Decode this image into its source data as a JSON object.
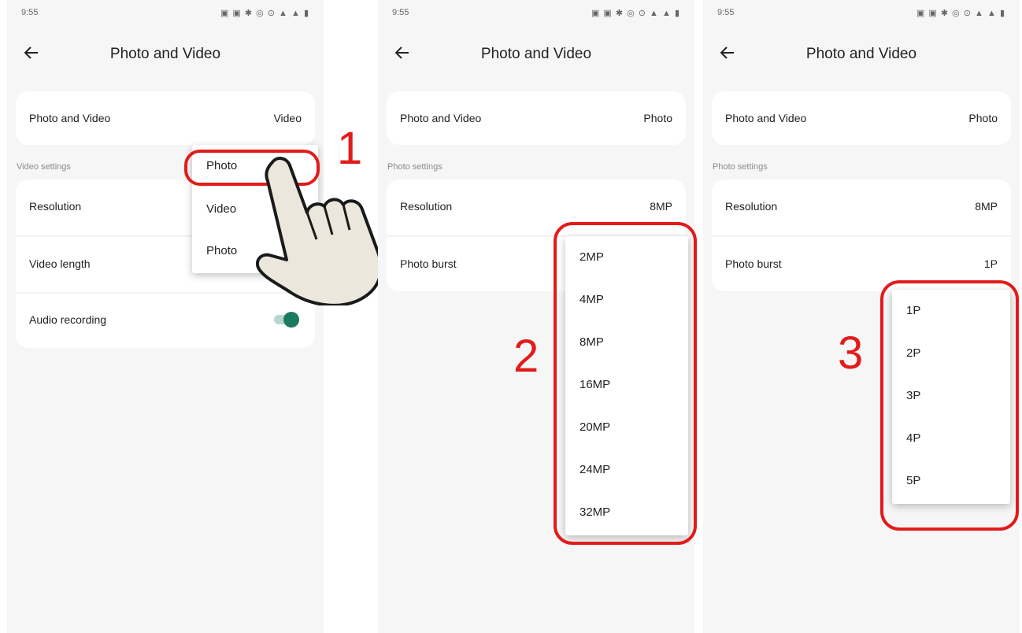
{
  "status_bar": {
    "time": "9:55",
    "icons_text": "▣ ▣ ✱ ◎ ⊙ ▲ ▲ ▮"
  },
  "screens": [
    {
      "title": "Photo and Video",
      "mode_row": {
        "label": "Photo and Video",
        "value": "Video"
      },
      "section_label": "Video settings",
      "rows": [
        {
          "label": "Resolution"
        },
        {
          "label": "Video length"
        },
        {
          "label": "Audio recording"
        }
      ],
      "audio_toggle": true,
      "menu_items": [
        "Photo",
        "Video",
        "Photo"
      ]
    },
    {
      "title": "Photo and Video",
      "mode_row": {
        "label": "Photo and Video",
        "value": "Photo"
      },
      "section_label": "Photo settings",
      "rows": [
        {
          "label": "Resolution",
          "value": "8MP"
        },
        {
          "label": "Photo burst"
        }
      ],
      "menu_items": [
        "2MP",
        "4MP",
        "8MP",
        "16MP",
        "20MP",
        "24MP",
        "32MP"
      ]
    },
    {
      "title": "Photo and Video",
      "mode_row": {
        "label": "Photo and Video",
        "value": "Photo"
      },
      "section_label": "Photo settings",
      "rows": [
        {
          "label": "Resolution",
          "value": "8MP"
        },
        {
          "label": "Photo burst",
          "value": "1P"
        }
      ],
      "menu_items": [
        "1P",
        "2P",
        "3P",
        "4P",
        "5P"
      ]
    }
  ],
  "step_numbers": [
    "1",
    "2",
    "3"
  ],
  "colors": {
    "highlight": "#e21b1b",
    "toggle_on": "#1c7a60",
    "background": "#f6f6f6",
    "card": "#ffffff"
  },
  "icons": {
    "back": "arrow-left-icon",
    "pointer": "pointing-hand-icon"
  }
}
